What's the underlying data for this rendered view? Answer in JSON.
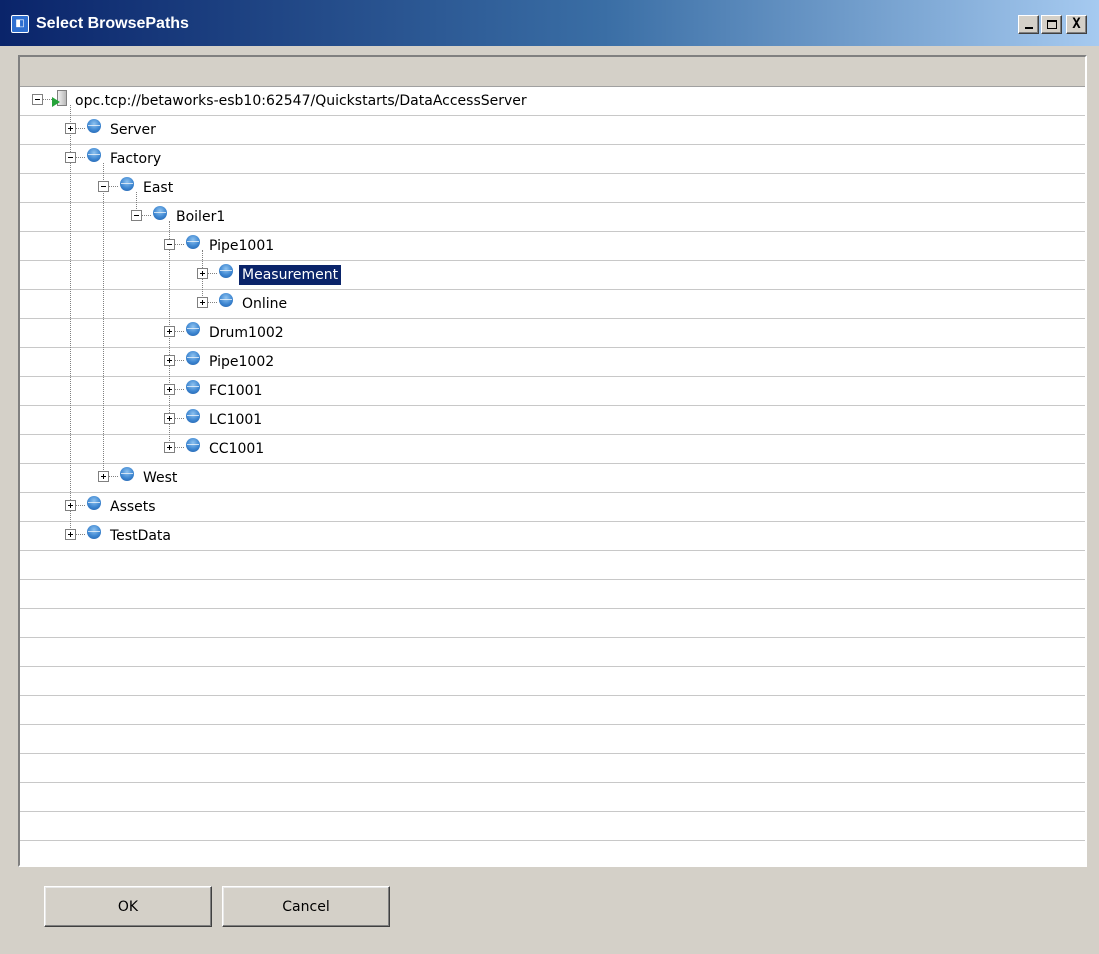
{
  "window": {
    "title": "Select BrowsePaths",
    "minimize_label": "",
    "maximize_label": "",
    "close_label": "X"
  },
  "tree": {
    "nodes": [
      {
        "label": "opc.tcp://betaworks-esb10:62547/Quickstarts/DataAccessServer",
        "depth": 0,
        "toggle": "minus",
        "icon": "server-icon"
      },
      {
        "label": "Server",
        "depth": 1,
        "toggle": "plus",
        "icon": "node-icon"
      },
      {
        "label": "Factory",
        "depth": 1,
        "toggle": "minus",
        "icon": "node-icon"
      },
      {
        "label": "East",
        "depth": 2,
        "toggle": "minus",
        "icon": "node-icon"
      },
      {
        "label": "Boiler1",
        "depth": 3,
        "toggle": "minus",
        "icon": "node-icon"
      },
      {
        "label": "Pipe1001",
        "depth": 4,
        "toggle": "minus",
        "icon": "node-icon"
      },
      {
        "label": "Measurement",
        "depth": 5,
        "toggle": "plus",
        "icon": "node-icon",
        "selected": true
      },
      {
        "label": "Online",
        "depth": 5,
        "toggle": "plus",
        "icon": "node-icon"
      },
      {
        "label": "Drum1002",
        "depth": 4,
        "toggle": "plus",
        "icon": "node-icon"
      },
      {
        "label": "Pipe1002",
        "depth": 4,
        "toggle": "plus",
        "icon": "node-icon"
      },
      {
        "label": "FC1001",
        "depth": 4,
        "toggle": "plus",
        "icon": "node-icon"
      },
      {
        "label": "LC1001",
        "depth": 4,
        "toggle": "plus",
        "icon": "node-icon"
      },
      {
        "label": "CC1001",
        "depth": 4,
        "toggle": "plus",
        "icon": "node-icon"
      },
      {
        "label": "West",
        "depth": 2,
        "toggle": "plus",
        "icon": "node-icon"
      },
      {
        "label": "Assets",
        "depth": 1,
        "toggle": "plus",
        "icon": "node-icon"
      },
      {
        "label": "TestData",
        "depth": 1,
        "toggle": "plus",
        "icon": "node-icon"
      }
    ]
  },
  "buttons": {
    "ok_label": "OK",
    "cancel_label": "Cancel"
  },
  "colors": {
    "selection": "#0a246a",
    "node_icon": "#3d86d1",
    "window_bg": "#d4d0c8"
  }
}
